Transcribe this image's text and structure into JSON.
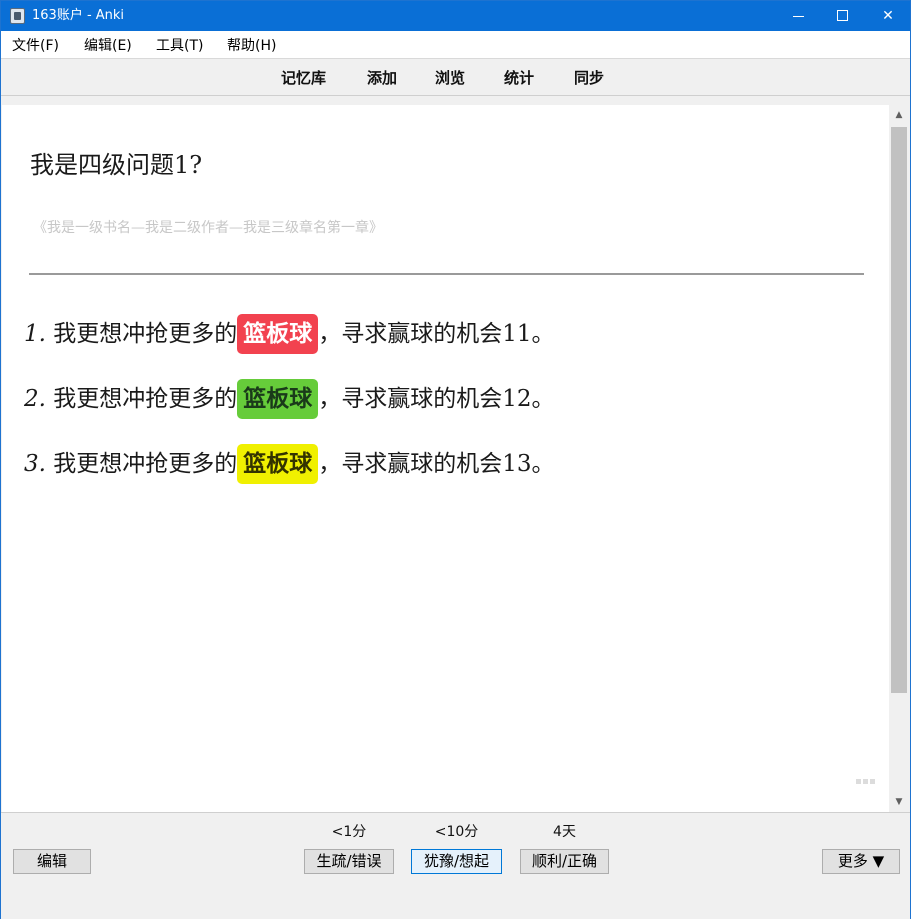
{
  "window": {
    "title": "163账户 - Anki"
  },
  "menu": [
    "文件(F)",
    "编辑(E)",
    "工具(T)",
    "帮助(H)"
  ],
  "toolbar": [
    "记忆库",
    "添加",
    "浏览",
    "统计",
    "同步"
  ],
  "card": {
    "question": "我是四级问题1?",
    "source": "《我是一级书名—我是二级作者—我是三级章名第一章》",
    "items": [
      {
        "num": "1.",
        "before": "我更想冲抢更多的",
        "tag": "篮板球",
        "after": "，寻求赢球的机会11。",
        "tag_color": "#f2424f"
      },
      {
        "num": "2.",
        "before": "我更想冲抢更多的",
        "tag": "篮板球",
        "after": "，寻求赢球的机会12。",
        "tag_color": "#66cc3a"
      },
      {
        "num": "3.",
        "before": "我更想冲抢更多的",
        "tag": "篮板球",
        "after": "，寻求赢球的机会13。",
        "tag_color": "#f0f000"
      }
    ]
  },
  "bottom": {
    "edit_label": "编辑",
    "answers": [
      {
        "interval": "<1分",
        "label": "生疏/错误"
      },
      {
        "interval": "<10分",
        "label": "犹豫/想起"
      },
      {
        "interval": "4天",
        "label": "顺利/正确"
      }
    ],
    "more_label": "更多 ▼"
  },
  "icons": {
    "minimize": "minimize-icon",
    "maximize": "maximize-icon",
    "close": "close-icon",
    "scroll_up": "chevron-up-icon",
    "scroll_down": "chevron-down-icon"
  }
}
